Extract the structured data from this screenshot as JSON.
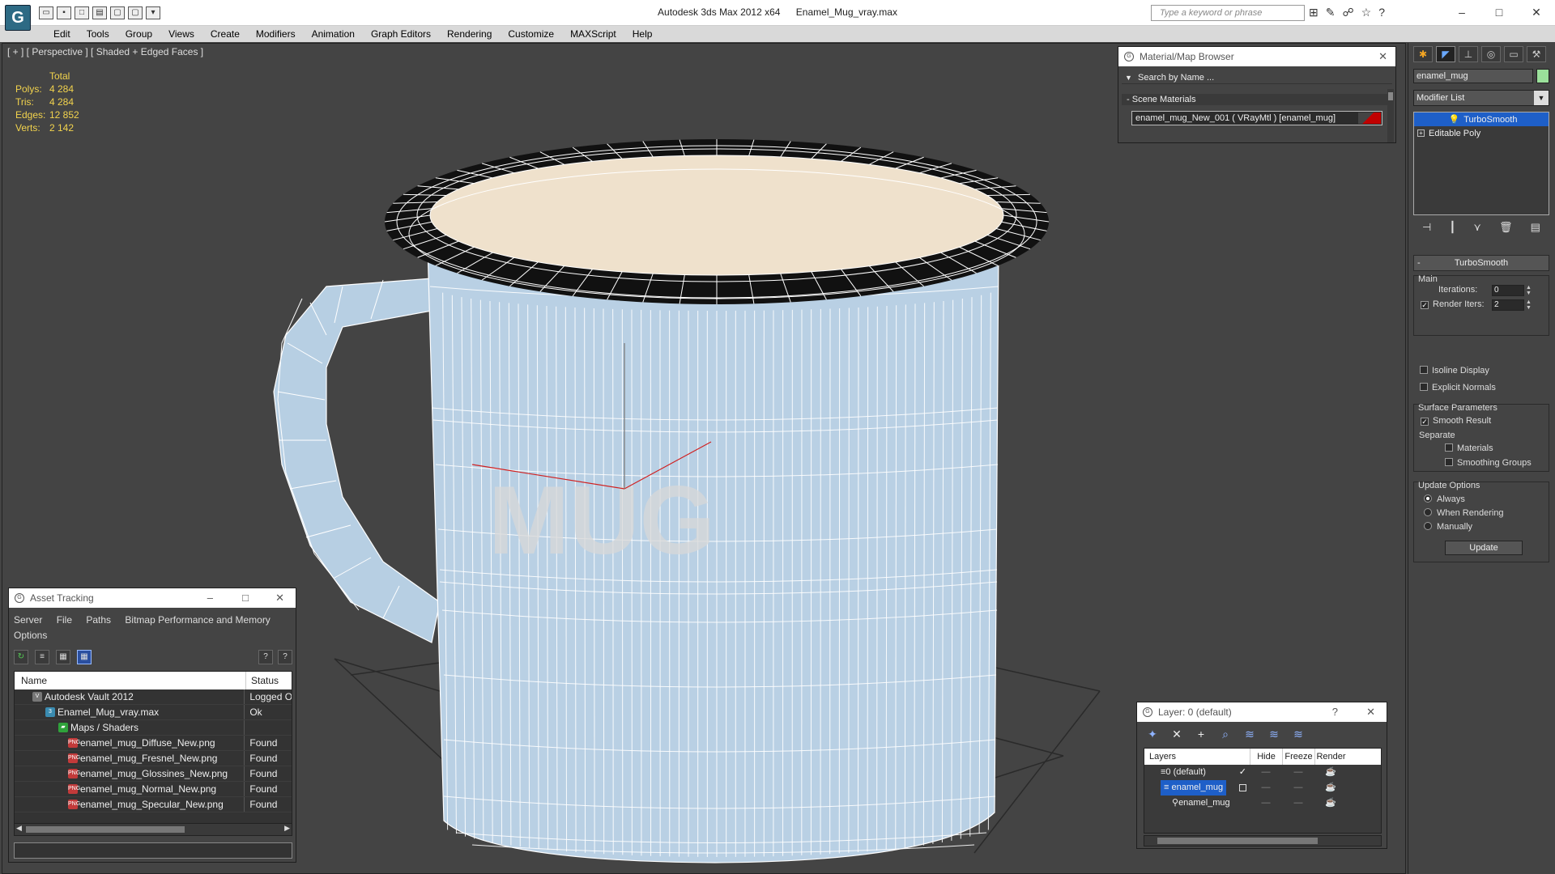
{
  "app": {
    "title_app": "Autodesk 3ds Max  2012 x64",
    "title_file": "Enamel_Mug_vray.max",
    "help_search_placeholder": "Type a keyword or phrase"
  },
  "menu": [
    "Edit",
    "Tools",
    "Group",
    "Views",
    "Create",
    "Modifiers",
    "Animation",
    "Graph Editors",
    "Rendering",
    "Customize",
    "MAXScript",
    "Help"
  ],
  "viewport": {
    "label": "[ + ] [ Perspective ] [ Shaded + Edged Faces ]",
    "stats": {
      "header": "Total",
      "polys_label": "Polys:",
      "polys": "4 284",
      "tris_label": "Tris:",
      "tris": "4 284",
      "edges_label": "Edges:",
      "edges": "12 852",
      "verts_label": "Verts:",
      "verts": "2 142"
    },
    "mug_text": "MUG",
    "colors": {
      "background": "#444444",
      "mug_body": "#b7cfe3",
      "mug_inside": "#efe1cc",
      "rim": "#111111",
      "wire": "#ffffff"
    }
  },
  "material_browser": {
    "title": "Material/Map Browser",
    "search": "Search by Name ...",
    "group": "Scene Materials",
    "item": "enamel_mug_New_001  ( VRayMtl ) [enamel_mug]"
  },
  "command_panel": {
    "object_name": "enamel_mug",
    "modifier_list": "Modifier List",
    "stack": [
      "TurboSmooth",
      "Editable Poly"
    ],
    "rollout_title": "TurboSmooth",
    "main": {
      "title": "Main",
      "iterations_label": "Iterations:",
      "iterations": "0",
      "render_iters_label": "Render Iters:",
      "render_iters": "2",
      "isoline": "Isoline Display",
      "explicit": "Explicit Normals"
    },
    "surface": {
      "title": "Surface Parameters",
      "smooth_result": "Smooth Result",
      "separate": "Separate",
      "materials": "Materials",
      "smoothing_groups": "Smoothing Groups"
    },
    "update": {
      "title": "Update Options",
      "always": "Always",
      "when_rendering": "When Rendering",
      "manually": "Manually",
      "button": "Update"
    }
  },
  "asset_tracking": {
    "title": "Asset Tracking",
    "menu": [
      "Server",
      "File",
      "Paths",
      "Bitmap Performance and Memory",
      "Options"
    ],
    "columns": [
      "Name",
      "Status"
    ],
    "rows": [
      {
        "name": "Autodesk Vault 2012",
        "status": "Logged Ou"
      },
      {
        "name": "Enamel_Mug_vray.max",
        "status": "Ok"
      },
      {
        "name": "Maps / Shaders",
        "status": ""
      },
      {
        "name": "enamel_mug_Diffuse_New.png",
        "status": "Found"
      },
      {
        "name": "enamel_mug_Fresnel_New.png",
        "status": "Found"
      },
      {
        "name": "enamel_mug_Glossines_New.png",
        "status": "Found"
      },
      {
        "name": "enamel_mug_Normal_New.png",
        "status": "Found"
      },
      {
        "name": "enamel_mug_Specular_New.png",
        "status": "Found"
      }
    ]
  },
  "layer_manager": {
    "title": "Layer: 0 (default)",
    "help": "?",
    "columns": [
      "Layers",
      "Hide",
      "Freeze",
      "Render"
    ],
    "rows": [
      {
        "name": "0 (default)"
      },
      {
        "name": "enamel_mug"
      },
      {
        "name": "enamel_mug"
      }
    ]
  }
}
